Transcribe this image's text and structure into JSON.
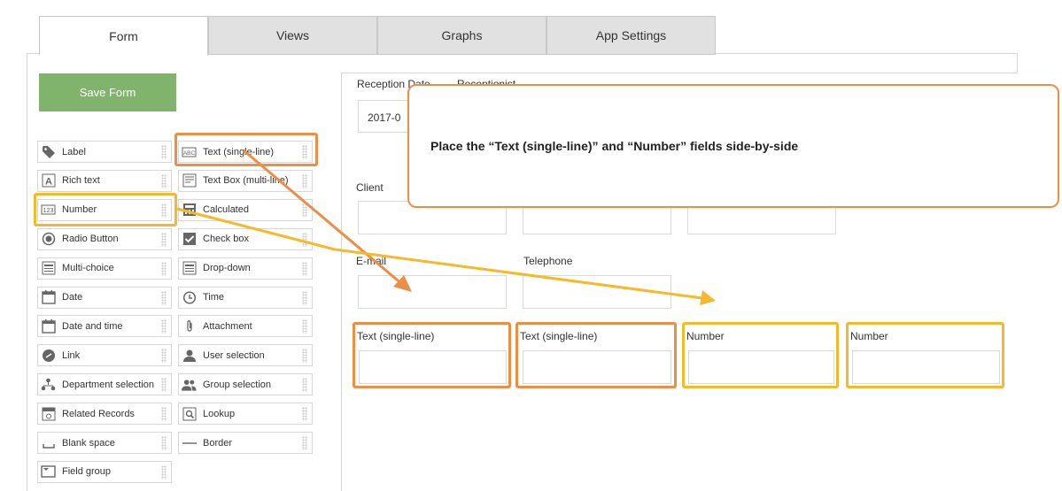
{
  "tabs": [
    "Form",
    "Views",
    "Graphs",
    "App Settings"
  ],
  "save_button": "Save Form",
  "palette": {
    "left": [
      {
        "label": "Label",
        "icon": "tag-icon"
      },
      {
        "label": "Rich text",
        "icon": "rich-text-icon"
      },
      {
        "label": "Number",
        "icon": "number-icon"
      },
      {
        "label": "Radio Button",
        "icon": "radio-button-icon"
      },
      {
        "label": "Multi-choice",
        "icon": "multi-choice-icon"
      },
      {
        "label": "Date",
        "icon": "date-icon"
      },
      {
        "label": "Date and time",
        "icon": "date-time-icon"
      },
      {
        "label": "Link",
        "icon": "link-icon"
      },
      {
        "label": "Department selection",
        "icon": "department-icon"
      },
      {
        "label": "Related Records",
        "icon": "related-records-icon"
      },
      {
        "label": "Blank space",
        "icon": "blank-space-icon"
      },
      {
        "label": "Field group",
        "icon": "field-group-icon"
      }
    ],
    "right": [
      {
        "label": "Text (single-line)",
        "icon": "text-single-line-icon"
      },
      {
        "label": "Text Box (multi-line)",
        "icon": "text-box-icon"
      },
      {
        "label": "Calculated",
        "icon": "calculator-icon"
      },
      {
        "label": "Check box",
        "icon": "checkbox-icon"
      },
      {
        "label": "Drop-down",
        "icon": "dropdown-icon"
      },
      {
        "label": "Time",
        "icon": "clock-icon"
      },
      {
        "label": "Attachment",
        "icon": "paperclip-icon"
      },
      {
        "label": "User selection",
        "icon": "user-icon"
      },
      {
        "label": "Group selection",
        "icon": "group-icon"
      },
      {
        "label": "Lookup",
        "icon": "lookup-icon"
      },
      {
        "label": "Border",
        "icon": "border-icon"
      }
    ]
  },
  "form": {
    "reception_date_label": "Reception Date",
    "receptionist_label": "Receptionist",
    "reception_date_value": "2017-0",
    "client_label": "Client",
    "email_label": "E-mail",
    "telephone_label": "Telephone",
    "text_field_1": "Text (single-line)",
    "text_field_2": "Text (single-line)",
    "number_field_1": "Number",
    "number_field_2": "Number"
  },
  "callout_text": "Place the “Text (single-line)” and “Number” fields side-by-side",
  "colors": {
    "orange": "#ee8d45",
    "yellow": "#f6b92b",
    "save_green": "#80b36b"
  }
}
